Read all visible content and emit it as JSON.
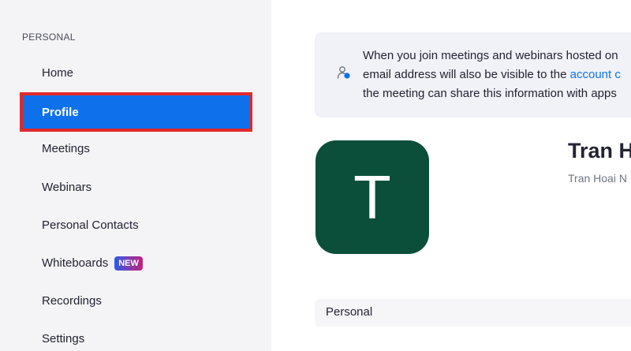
{
  "sidebar": {
    "section_label": "PERSONAL",
    "items": [
      {
        "label": "Home"
      },
      {
        "label": "Profile",
        "active": true
      },
      {
        "label": "Meetings"
      },
      {
        "label": "Webinars"
      },
      {
        "label": "Personal Contacts"
      },
      {
        "label": "Whiteboards",
        "badge": "NEW"
      },
      {
        "label": "Recordings"
      },
      {
        "label": "Settings"
      }
    ]
  },
  "notice": {
    "icon": "user-privacy-icon",
    "line1": "When you join meetings and webinars hosted on",
    "line2_prefix": "email address will also be visible to the",
    "line2_link": "account c",
    "line3": "the meeting can share this information with apps"
  },
  "profile": {
    "avatar_initial": "T",
    "name": "Tran H",
    "subtitle": "Tran Hoai N"
  },
  "section": {
    "label": "Personal"
  },
  "colors": {
    "active_bg": "#0e71eb",
    "highlight_border": "#e02a2a",
    "avatar_bg": "#0b4f3b",
    "link": "#0e71eb"
  }
}
